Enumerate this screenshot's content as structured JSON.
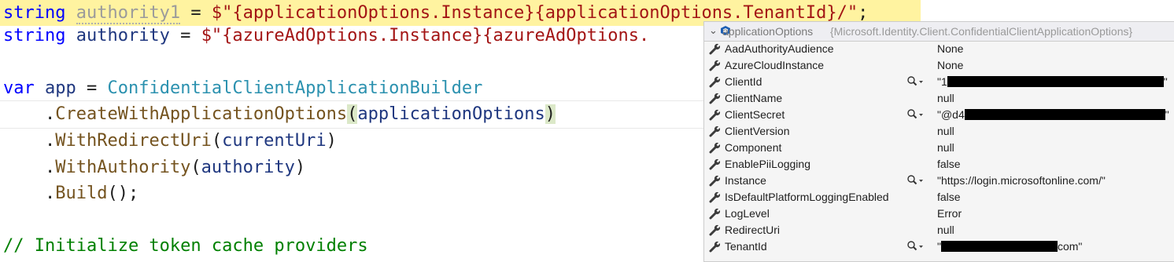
{
  "editor": {
    "lines": [
      {
        "segments": [
          {
            "t": "string ",
            "c": "kw"
          },
          {
            "t": "authority1",
            "c": "dim"
          },
          {
            "t": " = ",
            "c": ""
          },
          {
            "t": "$\"{applicationOptions.Instance}{applicationOptions.TenantId}/\"",
            "c": "str"
          },
          {
            "t": ";",
            "c": ""
          }
        ]
      },
      {
        "segments": [
          {
            "t": "string ",
            "c": "kw"
          },
          {
            "t": "authority",
            "c": "var"
          },
          {
            "t": " = ",
            "c": ""
          },
          {
            "t": "$\"{azureAdOptions.Instance}{azureAdOptions.",
            "c": "str"
          }
        ]
      },
      {
        "segments": []
      },
      {
        "segments": [
          {
            "t": "var ",
            "c": "kw"
          },
          {
            "t": "app",
            "c": "var"
          },
          {
            "t": " = ",
            "c": ""
          },
          {
            "t": "ConfidentialClientApplicationBuilder",
            "c": "type"
          }
        ]
      },
      {
        "segments": [
          {
            "t": "    .",
            "c": ""
          },
          {
            "t": "CreateWithApplicationOptions",
            "c": "mth"
          },
          {
            "t": "(",
            "c": "paren-hl"
          },
          {
            "t": "applicationOptions",
            "c": "var"
          },
          {
            "t": ")",
            "c": "paren-hl"
          }
        ]
      },
      {
        "segments": [
          {
            "t": "    .",
            "c": ""
          },
          {
            "t": "WithRedirectUri",
            "c": "mth"
          },
          {
            "t": "(",
            "c": ""
          },
          {
            "t": "currentUri",
            "c": "var"
          },
          {
            "t": ")",
            "c": ""
          }
        ]
      },
      {
        "segments": [
          {
            "t": "    .",
            "c": ""
          },
          {
            "t": "WithAuthority",
            "c": "mth"
          },
          {
            "t": "(",
            "c": ""
          },
          {
            "t": "authority",
            "c": "var"
          },
          {
            "t": ")",
            "c": ""
          }
        ]
      },
      {
        "segments": [
          {
            "t": "    .",
            "c": ""
          },
          {
            "t": "Build",
            "c": "mth"
          },
          {
            "t": "();",
            "c": ""
          }
        ]
      },
      {
        "segments": []
      },
      {
        "segments": [
          {
            "t": "// Initialize token cache providers",
            "c": "cmt"
          }
        ]
      }
    ]
  },
  "datatip": {
    "name": "applicationOptions",
    "type": "{Microsoft.Identity.Client.ConfidentialClientApplicationOptions}",
    "colors": {
      "wrench": "#3c3c3c",
      "redact": "#000000"
    },
    "rows": [
      {
        "name": "AadAuthorityAudience",
        "value": "None",
        "magnifier": false
      },
      {
        "name": "AzureCloudInstance",
        "value": "None",
        "magnifier": false
      },
      {
        "name": "ClientId",
        "value_prefix": "\"1",
        "value_suffix": "\"",
        "redacted": true,
        "magnifier": true
      },
      {
        "name": "ClientName",
        "value": "null",
        "magnifier": false
      },
      {
        "name": "ClientSecret",
        "value_prefix": "\"@d4",
        "value_suffix": "\"",
        "redacted": true,
        "magnifier": true
      },
      {
        "name": "ClientVersion",
        "value": "null",
        "magnifier": false
      },
      {
        "name": "Component",
        "value": "null",
        "magnifier": false
      },
      {
        "name": "EnablePiiLogging",
        "value": "false",
        "magnifier": false
      },
      {
        "name": "Instance",
        "value": "\"https://login.microsoftonline.com/\"",
        "magnifier": true
      },
      {
        "name": "IsDefaultPlatformLoggingEnabled",
        "value": "false",
        "magnifier": false
      },
      {
        "name": "LogLevel",
        "value": "Error",
        "magnifier": false
      },
      {
        "name": "RedirectUri",
        "value": "null",
        "magnifier": false
      },
      {
        "name": "TenantId",
        "value_prefix": "\"",
        "value_suffix": "com\"",
        "redacted": true,
        "magnifier": true
      }
    ]
  }
}
